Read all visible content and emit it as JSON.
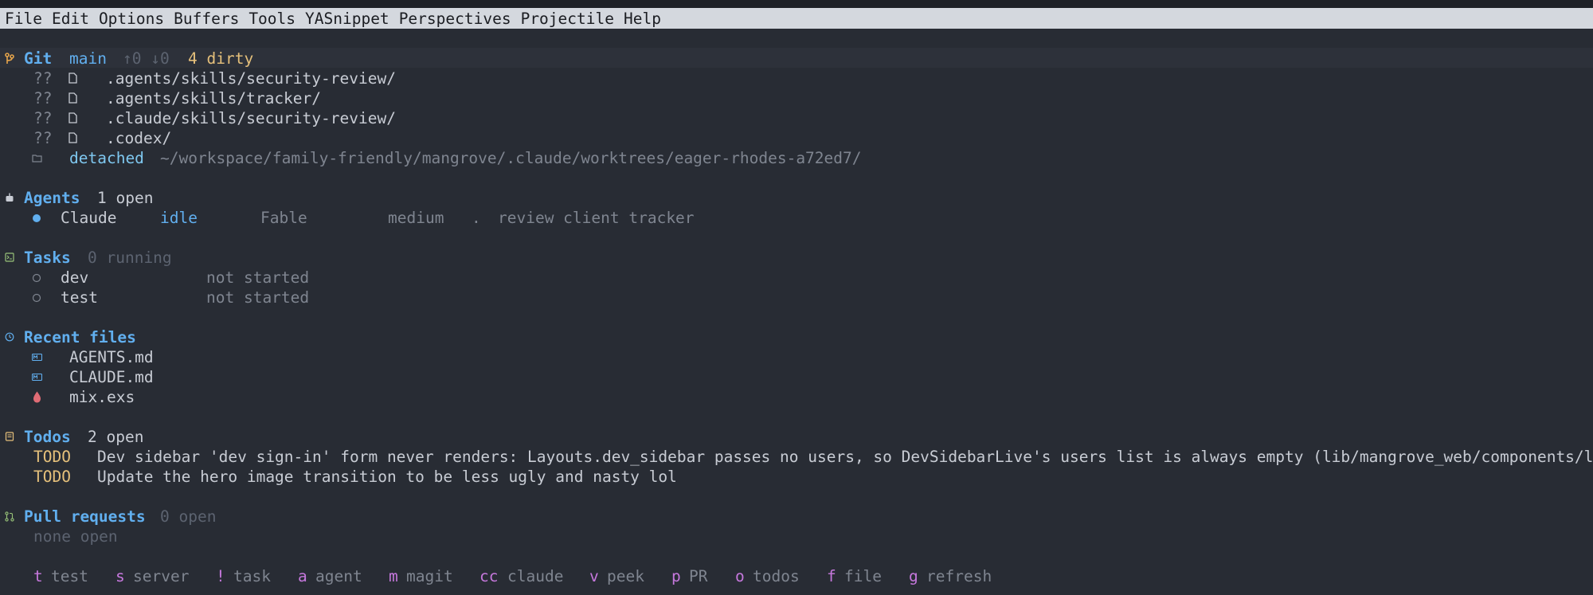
{
  "menu": [
    "File",
    "Edit",
    "Options",
    "Buffers",
    "Tools",
    "YASnippet",
    "Perspectives",
    "Projectile",
    "Help"
  ],
  "git": {
    "title": "Git",
    "branch": "main",
    "ahead_behind": "↑0 ↓0",
    "dirty": "4 dirty",
    "files": [
      {
        "status": "??",
        "path": ".agents/skills/security-review/"
      },
      {
        "status": "??",
        "path": ".agents/skills/tracker/"
      },
      {
        "status": "??",
        "path": ".claude/skills/security-review/"
      },
      {
        "status": "??",
        "path": ".codex/"
      }
    ],
    "worktree": {
      "label": "detached",
      "path": "~/workspace/family-friendly/mangrove/.claude/worktrees/eager-rhodes-a72ed7/"
    }
  },
  "agents": {
    "title": "Agents",
    "count": "1 open",
    "items": [
      {
        "name": "Claude",
        "state": "idle",
        "model": "Fable",
        "effort": "medium",
        "sep": ".",
        "task": "review client tracker"
      }
    ]
  },
  "tasks": {
    "title": "Tasks",
    "count": "0 running",
    "items": [
      {
        "name": "dev",
        "state": "not started"
      },
      {
        "name": "test",
        "state": "not started"
      }
    ]
  },
  "recent": {
    "title": "Recent files",
    "items": [
      {
        "name": "AGENTS.md",
        "icon": "markdown-icon"
      },
      {
        "name": "CLAUDE.md",
        "icon": "markdown-icon"
      },
      {
        "name": "mix.exs",
        "icon": "elixir-drop-icon"
      }
    ]
  },
  "todos": {
    "title": "Todos",
    "count": "2 open",
    "items": [
      {
        "tag": "TODO",
        "text": "Dev sidebar 'dev sign-in' form never renders: Layouts.dev_sidebar passes no users, so DevSidebarLive's users list is always empty (lib/mangrove_web/components/layou"
      },
      {
        "tag": "TODO",
        "text": "Update the hero image transition to be less ugly and nasty lol"
      }
    ]
  },
  "prs": {
    "title": "Pull requests",
    "count": "0 open",
    "empty": "none open"
  },
  "keys": [
    {
      "k": "t",
      "label": "test"
    },
    {
      "k": "s",
      "label": "server"
    },
    {
      "k": "!",
      "label": "task"
    },
    {
      "k": "a",
      "label": "agent"
    },
    {
      "k": "m",
      "label": "magit"
    },
    {
      "k": "cc",
      "label": "claude"
    },
    {
      "k": "v",
      "label": "peek"
    },
    {
      "k": "p",
      "label": "PR"
    },
    {
      "k": "o",
      "label": "todos"
    },
    {
      "k": "f",
      "label": "file"
    },
    {
      "k": "g",
      "label": "refresh"
    }
  ],
  "colors": {
    "background": "#282c34",
    "menubar": "#d4d8de",
    "header": "#61afef",
    "accent": "#c678dd",
    "todo": "#e5c07b"
  }
}
